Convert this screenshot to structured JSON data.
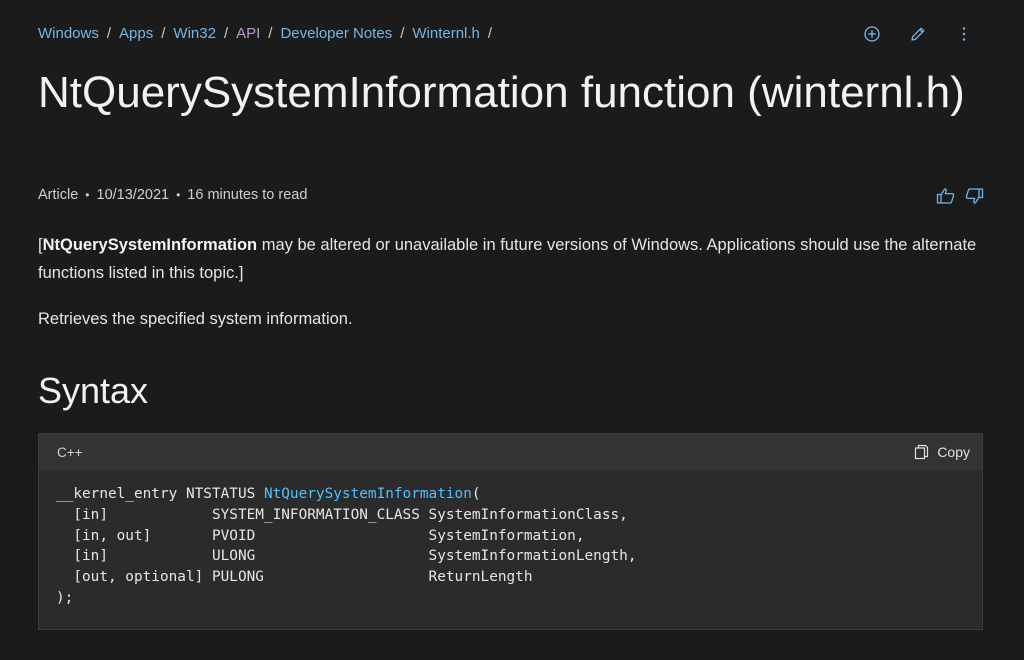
{
  "breadcrumb": [
    {
      "label": "Windows",
      "visited": false
    },
    {
      "label": "Apps",
      "visited": false
    },
    {
      "label": "Win32",
      "visited": false
    },
    {
      "label": "API",
      "visited": true
    },
    {
      "label": "Developer Notes",
      "visited": false
    },
    {
      "label": "Winternl.h",
      "visited": false
    }
  ],
  "breadcrumb_separator": "/",
  "actions": {
    "add_icon": "plus-circle-icon",
    "edit_icon": "pencil-icon",
    "more_icon": "more-vertical-icon"
  },
  "title": "NtQuerySystemInformation function (winternl.h)",
  "meta": {
    "type": "Article",
    "date": "10/13/2021",
    "read_time": "16 minutes to read",
    "dot": "•"
  },
  "feedback": {
    "thumbs_up_icon": "thumbs-up-icon",
    "thumbs_down_icon": "thumbs-down-icon"
  },
  "intro": {
    "open_bracket": "[",
    "bold": "NtQuerySystemInformation",
    "rest": " may be altered or unavailable in future versions of Windows. Applications should use the alternate functions listed in this topic.]"
  },
  "summary": "Retrieves the specified system information.",
  "syntax_heading": "Syntax",
  "code": {
    "language": "C++",
    "copy_label": "Copy",
    "prefix": "__kernel_entry NTSTATUS ",
    "function_name": "NtQuerySystemInformation",
    "suffix": "(",
    "lines": [
      "  [in]            SYSTEM_INFORMATION_CLASS SystemInformationClass,",
      "  [in, out]       PVOID                    SystemInformation,",
      "  [in]            ULONG                    SystemInformationLength,",
      "  [out, optional] PULONG                   ReturnLength",
      ");"
    ]
  },
  "colors": {
    "link": "#75b6e7",
    "visited_link": "#b79ad9",
    "function_highlight": "#4fc1ff",
    "background": "#1b1b1b"
  }
}
